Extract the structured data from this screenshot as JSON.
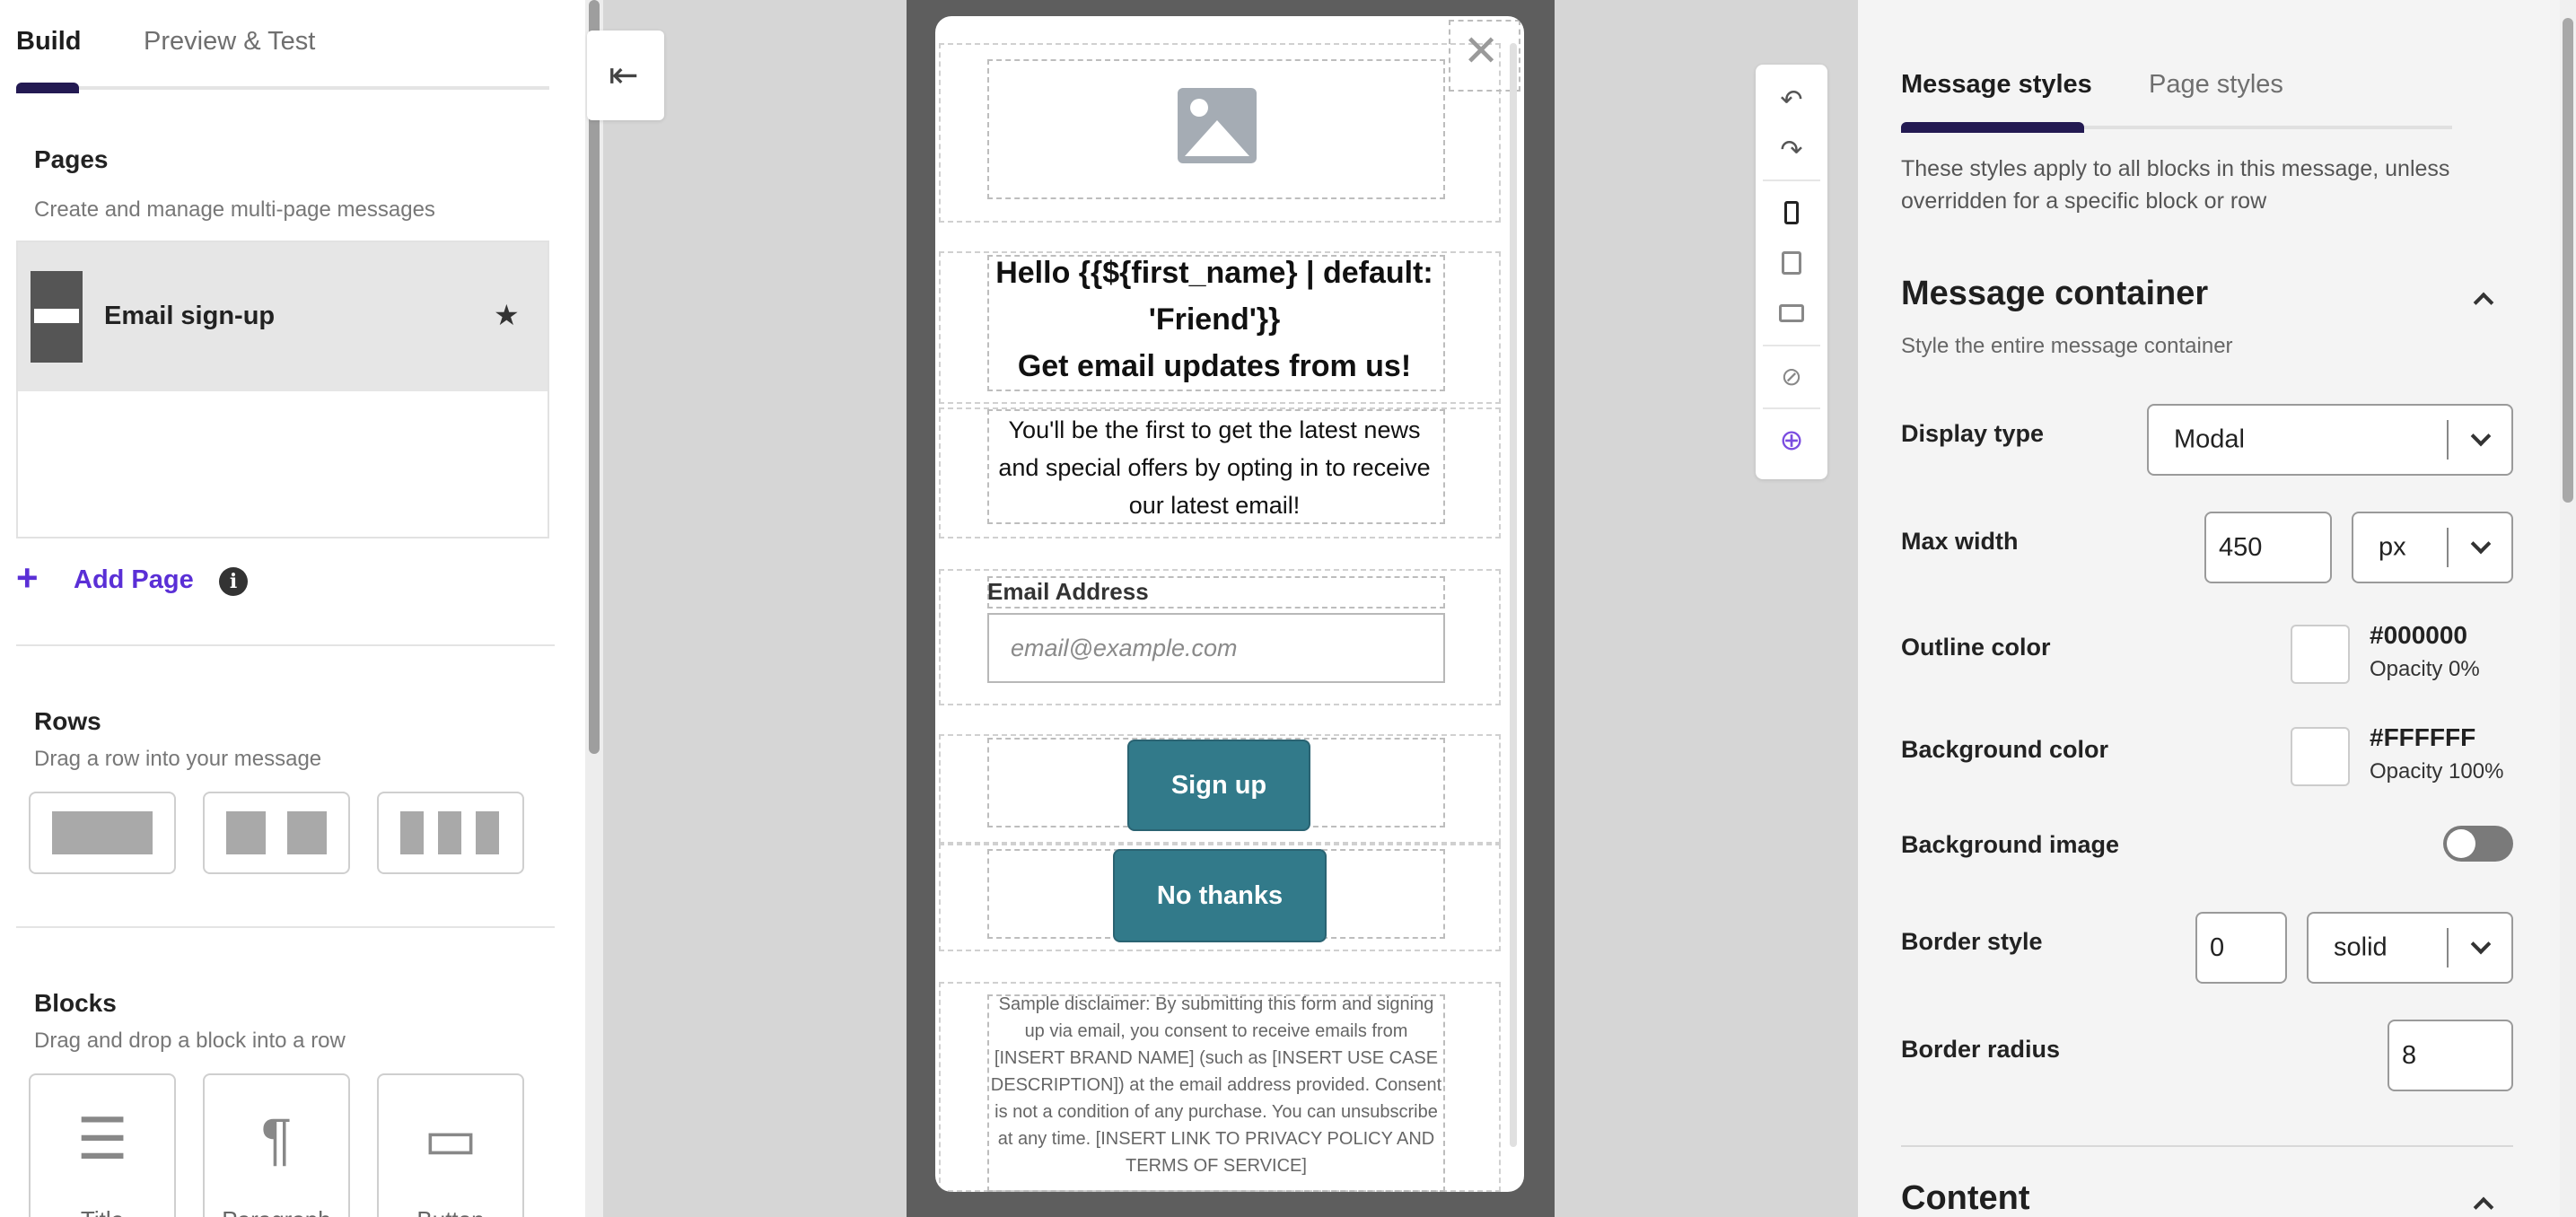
{
  "left": {
    "tabs": [
      "Build",
      "Preview & Test"
    ],
    "pages": {
      "title": "Pages",
      "subtitle": "Create and manage multi-page messages",
      "items": [
        {
          "name": "Email sign-up"
        }
      ],
      "add_label": "Add Page"
    },
    "rows": {
      "title": "Rows",
      "subtitle": "Drag a row into your message"
    },
    "blocks": {
      "title": "Blocks",
      "subtitle": "Drag and drop a block into a row",
      "items": [
        "Title",
        "Paragraph",
        "Button"
      ]
    }
  },
  "canvas": {
    "headline_line1": "Hello {{${first_name} | default:",
    "headline_line2": "'Friend'}}",
    "headline_line3": "Get email updates from us!",
    "body": "You'll be the first to get the latest news and special offers by opting in to receive our latest email!",
    "email_label": "Email Address",
    "email_placeholder": "email@example.com",
    "primary_button": "Sign up",
    "secondary_button": "No thanks",
    "disclaimer": "Sample disclaimer: By submitting this form and signing up via email, you consent to receive emails from [INSERT BRAND NAME] (such as [INSERT USE CASE DESCRIPTION]) at the email address provided. Consent is not a condition of any purchase. You can unsubscribe at any time. [INSERT LINK TO PRIVACY POLICY AND TERMS OF SERVICE]",
    "button_color": "#327A8A"
  },
  "right": {
    "tabs": [
      "Message styles",
      "Page styles"
    ],
    "note": "These styles apply to all blocks in this message, unless overridden for a specific block or row",
    "container": {
      "title": "Message container",
      "subtitle": "Style the entire message container"
    },
    "fields": {
      "display_type_label": "Display type",
      "display_type_value": "Modal",
      "max_width_label": "Max width",
      "max_width_value": "450",
      "max_width_unit": "px",
      "outline_label": "Outline color",
      "outline_hex": "#000000",
      "outline_opacity": "Opacity 0%",
      "bg_label": "Background color",
      "bg_hex": "#FFFFFF",
      "bg_opacity": "Opacity 100%",
      "bg_image_label": "Background image",
      "bg_image_enabled": false,
      "border_style_label": "Border style",
      "border_width_value": "0",
      "border_style_value": "solid",
      "border_radius_label": "Border radius",
      "border_radius_value": "8"
    },
    "content_title": "Content"
  },
  "colors": {
    "accent": "#5A2FD6",
    "tab_indicator": "#231A52"
  },
  "icons": [
    "collapse-panel-icon",
    "undo-icon",
    "redo-icon",
    "mobile-icon",
    "tablet-icon",
    "desktop-icon",
    "hide-icon",
    "add-circle-icon",
    "star-icon",
    "info-icon",
    "close-icon",
    "image-placeholder-icon"
  ]
}
